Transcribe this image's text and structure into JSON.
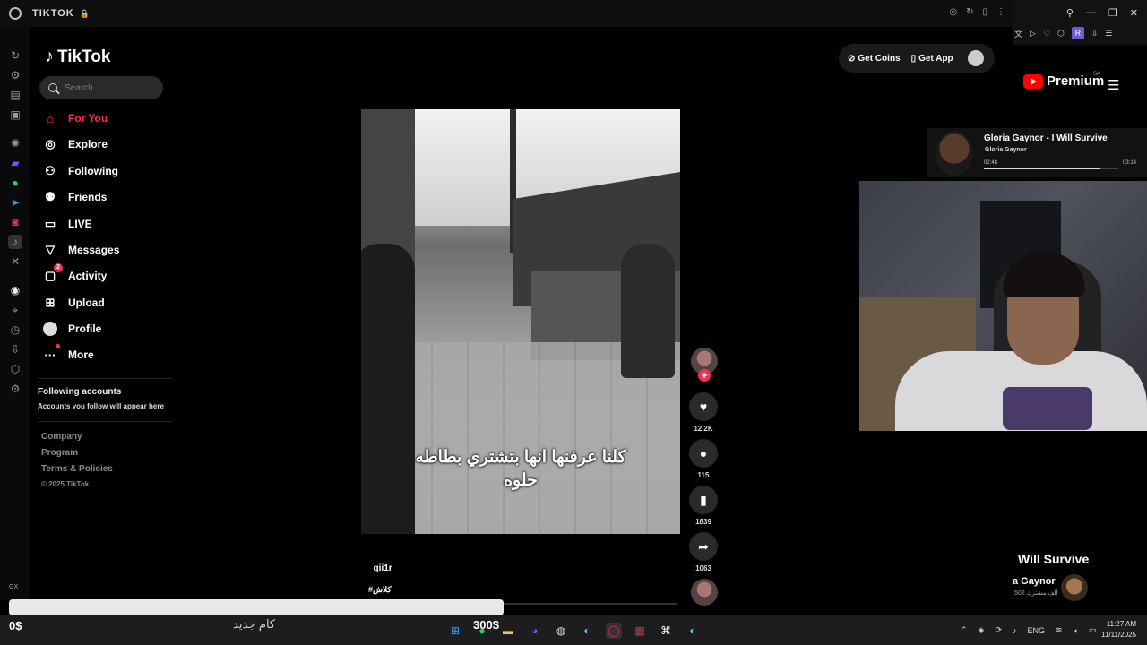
{
  "window": {
    "tab_title": "TIKTOK",
    "gx_label": "GX"
  },
  "tiktok": {
    "logo_text": "TikTok",
    "search_placeholder": "Search",
    "nav": [
      {
        "label": "For You",
        "icon": "home-icon"
      },
      {
        "label": "Explore",
        "icon": "compass-icon"
      },
      {
        "label": "Following",
        "icon": "following-icon"
      },
      {
        "label": "Friends",
        "icon": "friends-icon"
      },
      {
        "label": "LIVE",
        "icon": "live-icon"
      },
      {
        "label": "Messages",
        "icon": "messages-icon"
      },
      {
        "label": "Activity",
        "icon": "activity-icon",
        "badge": "2"
      },
      {
        "label": "Upload",
        "icon": "upload-icon"
      },
      {
        "label": "Profile",
        "icon": "profile-icon"
      },
      {
        "label": "More",
        "icon": "more-icon"
      }
    ],
    "following_accounts_title": "Following accounts",
    "following_accounts_sub": "Accounts you follow will appear here",
    "footer_links": [
      "Company",
      "Program",
      "Terms & Policies"
    ],
    "copyright": "© 2025 TikTok",
    "top_actions": {
      "get_coins": "Get Coins",
      "get_app": "Get App"
    },
    "video": {
      "caption": "كلنا عرفنها انها بتشتري بطاطه حلوه",
      "username": "_qii1r",
      "hashtag": "#كلاش",
      "likes": "12.2K",
      "comments": "115",
      "saves": "1839",
      "shares": "1063"
    }
  },
  "youtube": {
    "brand": "Premium",
    "region": "SA",
    "avatar_letter": "R",
    "now_playing": {
      "title": "Gloria Gaynor - I Will Survive",
      "artist": "Gloria Gaynor",
      "elapsed": "02:48",
      "duration": "03:14",
      "progress": 0.866
    },
    "song_title_partial": "Will Survive",
    "artist_partial": "a Gaynor",
    "subscribers": "502 ألف مشترك"
  },
  "overlay": {
    "money": "0$",
    "arabic_label": "كام جديد",
    "goal": "300$"
  },
  "taskbar": {
    "lang": "ENG",
    "time": "11:27 AM",
    "date": "11/11/2025"
  }
}
